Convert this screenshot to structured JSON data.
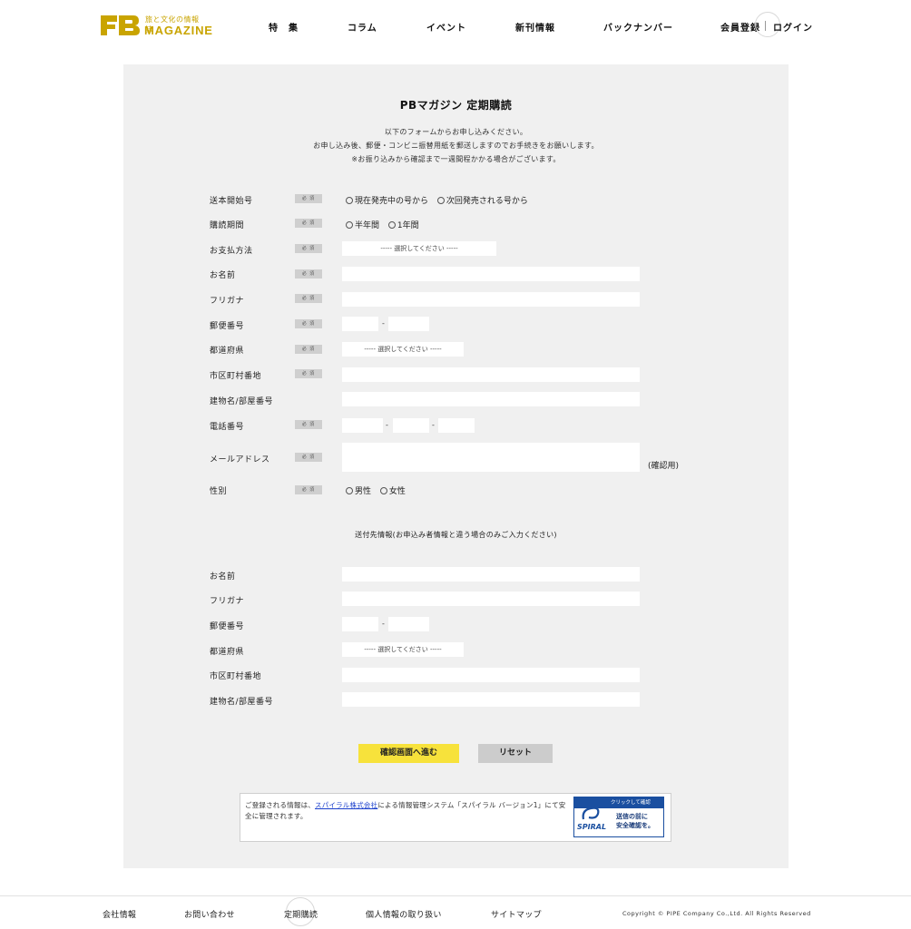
{
  "header": {
    "logo_tagline": "旅と文化の情報誌",
    "logo_text": "MAGAZINE",
    "nav": [
      "特　集",
      "コラム",
      "イベント",
      "新刊情報",
      "バックナンバー"
    ],
    "register": "会員登録",
    "login": "ログイン"
  },
  "form": {
    "title": "PBマガジン 定期購読",
    "intro": [
      "以下のフォームからお申し込みください。",
      "お申し込み後、郵便・コンビニ振替用紙を郵送しますのでお手続きをお願いします。",
      "※お振り込みから確認まで一週間程かかる場合がございます。"
    ],
    "required_badge": "必 須",
    "select_placeholder": "----- 選択してください -----",
    "dash": "-",
    "labels": {
      "start_issue": "送本開始号",
      "period": "購読期間",
      "payment": "お支払方法",
      "name": "お名前",
      "furigana": "フリガナ",
      "postal": "郵便番号",
      "prefecture": "都道府県",
      "city": "市区町村番地",
      "building": "建物名/部屋番号",
      "phone": "電話番号",
      "email": "メールアドレス",
      "gender": "性別"
    },
    "start_issue_options": [
      "現在発売中の号から",
      "次回発売される号から"
    ],
    "period_options": [
      "半年間",
      "1年間"
    ],
    "gender_options": [
      "男性",
      "女性"
    ],
    "email_confirm_note": "(確認用)",
    "delivery_heading": "送付先情報(お申込み者情報と違う場合のみご入力ください)",
    "submit_label": "確認画面へ進む",
    "reset_label": "リセット",
    "notice_before": "ご登録される情報は、",
    "notice_link": "スパイラル株式会社",
    "notice_after": "による情報管理システム「スパイラル バージョン1」にて安全に管理されます。",
    "spiral_badge": {
      "top": "クリックして確認",
      "logo": "SPIRAL",
      "line1": "送信の前に",
      "line2": "安全確認を。"
    }
  },
  "footer": {
    "links": [
      "会社情報",
      "お問い合わせ",
      "定期購読",
      "個人情報の取り扱い",
      "サイトマップ"
    ],
    "copyright": "Copyright © PIPE Company Co.,Ltd. All Rights Reserved"
  },
  "colors": {
    "brand": "#c9a400",
    "panel": "#f0f0f0",
    "submit": "#f7e23b",
    "reset": "#cccccc",
    "link": "#1a3fcc"
  }
}
